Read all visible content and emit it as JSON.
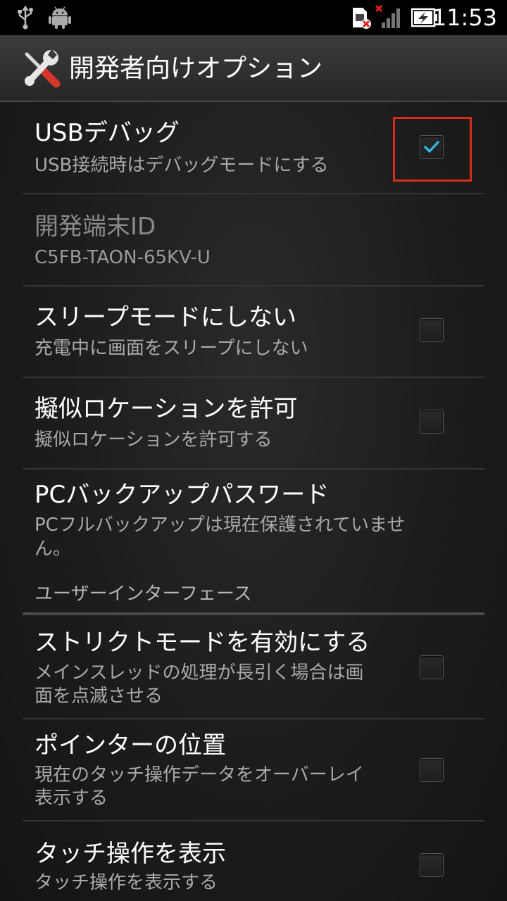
{
  "status_bar": {
    "time": "11:53",
    "icons": [
      "usb-icon",
      "android-debug-icon",
      "sim-error-icon",
      "signal-no-service-icon",
      "battery-charging-icon"
    ]
  },
  "action_bar": {
    "title": "開発者向けオプション",
    "icon": "tools-icon"
  },
  "settings": [
    {
      "title": "USBデバッグ",
      "summary": "USB接続時はデバッグモードにする",
      "checked": true
    },
    {
      "title": "開発端末ID",
      "summary": "C5FB-TAON-65KV-U"
    },
    {
      "title": "スリープモードにしない",
      "summary": "充電中に画面をスリープにしない",
      "checked": false
    },
    {
      "title": "擬似ロケーションを許可",
      "summary": "擬似ロケーションを許可する",
      "checked": false
    },
    {
      "title": "PCバックアップパスワード",
      "summary_line1": "PCフルバックアップは現在保護されていませ",
      "summary_line2": "ん。"
    },
    {
      "title": "ストリクトモードを有効にする",
      "summary_line1": "メインスレッドの処理が長引く場合は画",
      "summary_line2": "面を点滅させる",
      "checked": false
    },
    {
      "title": "ポインターの位置",
      "summary_line1": "現在のタッチ操作データをオーバーレイ",
      "summary_line2": "表示する",
      "checked": false
    },
    {
      "title": "タッチ操作を表示",
      "summary": "タッチ操作を表示する",
      "checked": false
    }
  ],
  "section_header": "ユーザーインターフェース",
  "colors": {
    "checkmark": "#33b5e5",
    "highlight": "#d62d18",
    "background": "#1c1c1c"
  }
}
